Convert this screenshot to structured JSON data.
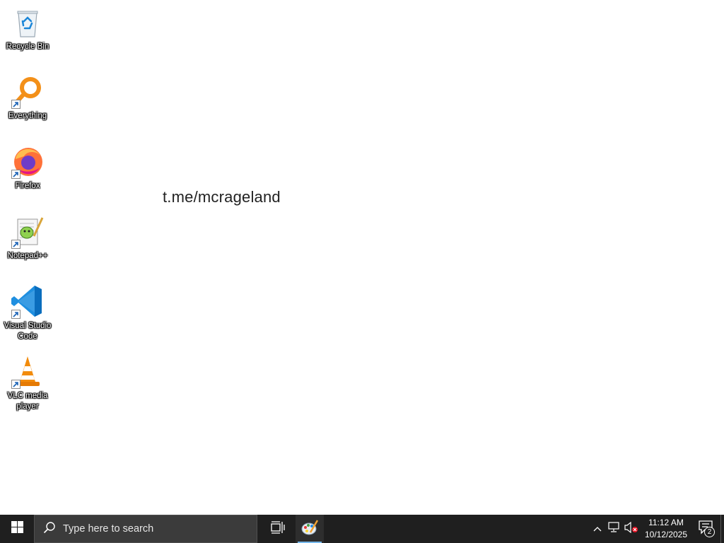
{
  "desktop": {
    "icons": [
      {
        "label": "Recycle Bin",
        "icon": "recycle-bin-icon"
      },
      {
        "label": "Everything",
        "icon": "everything-search-icon"
      },
      {
        "label": "Firefox",
        "icon": "firefox-icon"
      },
      {
        "label": "Notepad++",
        "icon": "notepad-plus-plus-icon"
      },
      {
        "label": "Visual Studio Code",
        "icon": "vscode-icon"
      },
      {
        "label": "VLC media player",
        "icon": "vlc-icon"
      }
    ],
    "wallpaper_text": "t.me/mcrageland"
  },
  "taskbar": {
    "search_placeholder": "Type here to search",
    "clock_time": "11:12 AM",
    "clock_date": "10/12/2025",
    "notification_count": "2",
    "accent_color": "#76b9ed"
  }
}
